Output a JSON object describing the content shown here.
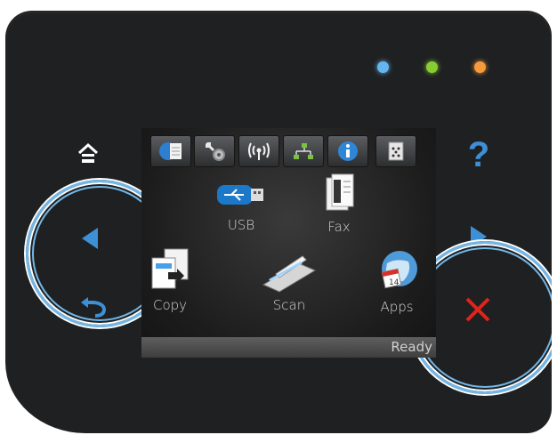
{
  "caption": "",
  "indicators": {
    "colors": {
      "blue": "#65b6ee",
      "green": "#86cc32",
      "orange": "#f59a3d"
    }
  },
  "tabs": [
    {
      "name": "document-tab",
      "icon": "document-icon"
    },
    {
      "name": "setup-tab",
      "icon": "wrench-gear-icon"
    },
    {
      "name": "wireless-tab",
      "icon": "wireless-icon"
    },
    {
      "name": "network-tab",
      "icon": "network-icon"
    },
    {
      "name": "info-tab",
      "icon": "info-icon"
    },
    {
      "name": "supplies-tab",
      "icon": "toner-icon"
    }
  ],
  "apps": {
    "usb": "USB",
    "fax": "Fax",
    "copy": "Copy",
    "scan": "Scan",
    "apps": "Apps"
  },
  "status": "Ready",
  "buttons": {
    "help_label": "?",
    "accent": "#3d8fd6",
    "cancel_color": "#e0241b"
  }
}
